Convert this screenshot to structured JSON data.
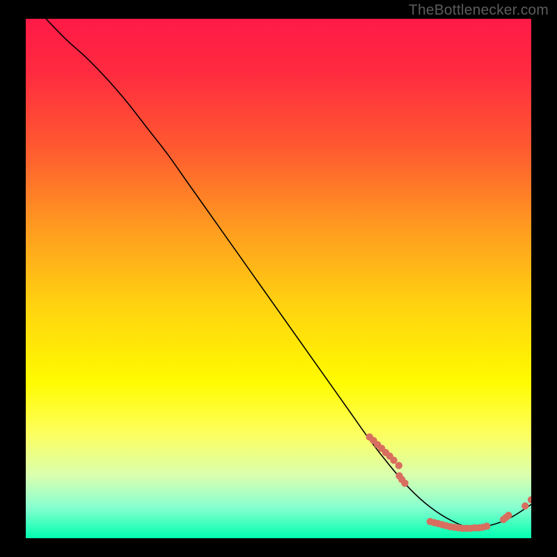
{
  "watermark": "TheBottlenecker.com",
  "gradient": {
    "stops": [
      {
        "offset": 0.0,
        "color": "#ff1a47"
      },
      {
        "offset": 0.1,
        "color": "#ff2a40"
      },
      {
        "offset": 0.25,
        "color": "#ff5a30"
      },
      {
        "offset": 0.4,
        "color": "#ff9a20"
      },
      {
        "offset": 0.55,
        "color": "#ffd210"
      },
      {
        "offset": 0.7,
        "color": "#fffb00"
      },
      {
        "offset": 0.8,
        "color": "#fdff60"
      },
      {
        "offset": 0.88,
        "color": "#d9ffb0"
      },
      {
        "offset": 0.94,
        "color": "#88ffd0"
      },
      {
        "offset": 1.0,
        "color": "#00ffb0"
      }
    ]
  },
  "point_color": "#d86e5f",
  "curve_color": "#000000",
  "chart_data": {
    "type": "line",
    "title": "",
    "xlabel": "",
    "ylabel": "",
    "xlim": [
      0,
      100
    ],
    "ylim": [
      0,
      100
    ],
    "series": [
      {
        "name": "curve",
        "x": [
          4,
          8,
          12,
          16,
          20,
          24,
          28,
          32,
          36,
          40,
          44,
          48,
          52,
          56,
          60,
          64,
          68,
          72,
          76,
          80,
          84,
          88,
          92,
          96,
          100
        ],
        "y": [
          100,
          96,
          92.5,
          88.5,
          84,
          79,
          74,
          68.5,
          63,
          57.5,
          52,
          46.5,
          41,
          35.5,
          30,
          24.5,
          19,
          14,
          9.5,
          6,
          3.5,
          2,
          2.5,
          4,
          6.5
        ]
      }
    ],
    "scatter_clusters": [
      {
        "name": "left-cluster",
        "points": [
          {
            "x": 68,
            "y": 19.5
          },
          {
            "x": 68.8,
            "y": 18.8
          },
          {
            "x": 69.6,
            "y": 18.0
          },
          {
            "x": 70.4,
            "y": 17.3
          },
          {
            "x": 71.2,
            "y": 16.5
          },
          {
            "x": 72.0,
            "y": 15.8
          },
          {
            "x": 72.8,
            "y": 15.0
          },
          {
            "x": 73.8,
            "y": 14.0
          },
          {
            "x": 73.9,
            "y": 12.0
          },
          {
            "x": 74.4,
            "y": 11.3
          },
          {
            "x": 75.0,
            "y": 10.6
          }
        ]
      },
      {
        "name": "bottom-cluster",
        "points": [
          {
            "x": 80.0,
            "y": 3.2
          },
          {
            "x": 80.8,
            "y": 3.0
          },
          {
            "x": 81.6,
            "y": 2.8
          },
          {
            "x": 82.4,
            "y": 2.6
          },
          {
            "x": 83.2,
            "y": 2.4
          },
          {
            "x": 84.0,
            "y": 2.2
          },
          {
            "x": 84.8,
            "y": 2.1
          },
          {
            "x": 85.6,
            "y": 2.0
          },
          {
            "x": 86.4,
            "y": 1.9
          },
          {
            "x": 87.2,
            "y": 1.9
          },
          {
            "x": 88.0,
            "y": 1.9
          },
          {
            "x": 88.8,
            "y": 2.0
          },
          {
            "x": 89.6,
            "y": 2.0
          },
          {
            "x": 90.4,
            "y": 2.1
          },
          {
            "x": 91.2,
            "y": 2.3
          }
        ]
      },
      {
        "name": "right-cluster",
        "points": [
          {
            "x": 94.5,
            "y": 3.6
          },
          {
            "x": 95.0,
            "y": 4.0
          },
          {
            "x": 95.5,
            "y": 4.4
          },
          {
            "x": 98.8,
            "y": 6.2
          },
          {
            "x": 100.0,
            "y": 7.4
          }
        ]
      }
    ]
  }
}
